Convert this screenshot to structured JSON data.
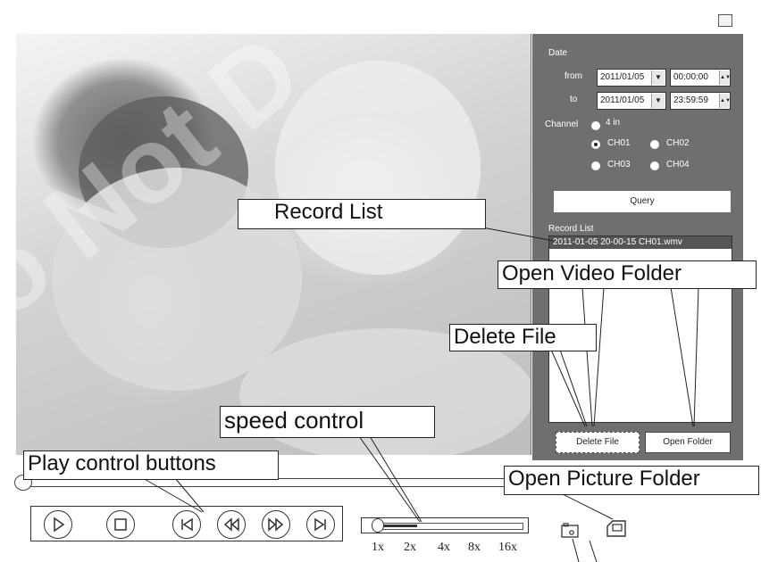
{
  "date_panel": {
    "date_label": "Date",
    "from_label": "from",
    "from_date": "2011/01/05",
    "from_time": "00:00:00",
    "to_label": "to",
    "to_date": "2011/01/05",
    "to_time": "23:59:59",
    "channel_label": "Channel",
    "channel_options": [
      "4 in",
      "CH01",
      "CH02",
      "CH03",
      "CH04"
    ],
    "selected_channel": "CH01",
    "query_label": "Query",
    "record_list_label": "Record List",
    "record_items": [
      "2011-01-05 20-00-15 CH01.wmv"
    ],
    "delete_label": "Delete File",
    "open_folder_label": "Open Folder"
  },
  "speed": {
    "ticks": [
      "1x",
      "2x",
      "4x",
      "8x",
      "16x"
    ],
    "position": 0.0
  },
  "callouts": {
    "record_list": "Record List",
    "open_video_folder": "Open Video Folder",
    "delete_file": "Delete File",
    "speed_control": "speed control",
    "play_control": "Play control buttons",
    "open_picture_folder": "Open Picture Folder"
  },
  "icons": [
    "play-icon",
    "stop-icon",
    "skip-back-icon",
    "rewind-icon",
    "fast-forward-icon",
    "skip-forward-icon",
    "snapshot-icon",
    "picture-folder-icon",
    "restore-icon"
  ],
  "colors": {
    "panel_bg": "#6f6f6f",
    "selected_row": "#555555"
  }
}
